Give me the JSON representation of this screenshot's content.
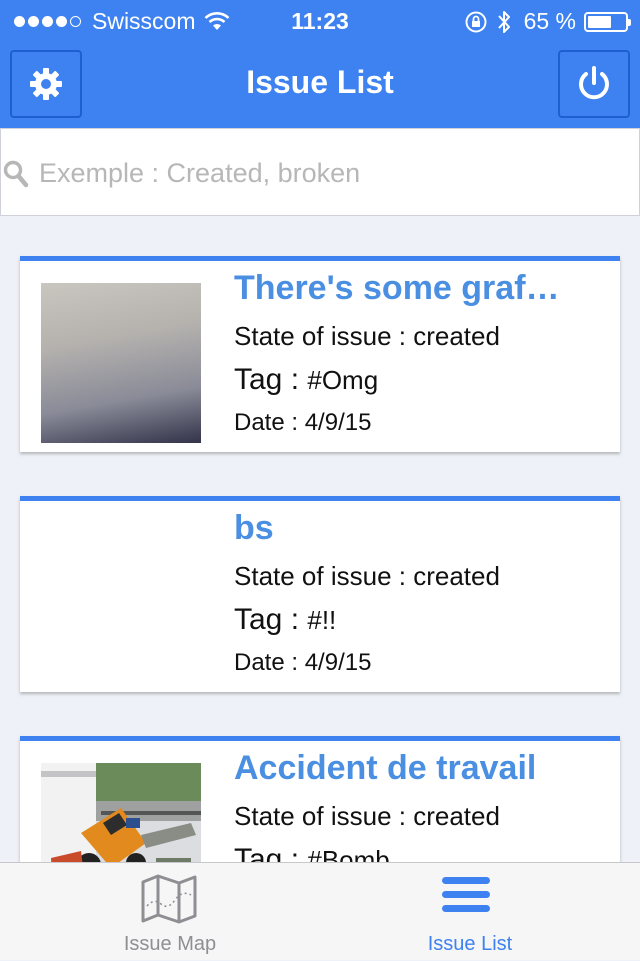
{
  "status_bar": {
    "carrier": "Swisscom",
    "time": "11:23",
    "battery": "65 %",
    "battery_level": 0.65,
    "signal_bars_filled": 4,
    "signal_bars_total": 5
  },
  "header": {
    "title": "Issue List",
    "left_icon": "gear-icon",
    "right_icon": "power-icon"
  },
  "search": {
    "placeholder": "Exemple : Created, broken",
    "value": ""
  },
  "issues": [
    {
      "title": "There's some graf…",
      "state": "State of issue : created",
      "tag_label": "Tag : ",
      "tag_value": "#Omg",
      "date": "Date : 4/9/15",
      "thumbnail": "blurred-wall-photo"
    },
    {
      "title": "bs",
      "state": "State of issue : created",
      "tag_label": "Tag : ",
      "tag_value": "#!!",
      "date": "Date : 4/9/15",
      "thumbnail": ""
    },
    {
      "title": "Accident de travail",
      "state": "State of issue : created",
      "tag_label": "Tag : ",
      "tag_value": "#Bomb",
      "date": "",
      "thumbnail": "forklift-accident-photo"
    }
  ],
  "tabs": [
    {
      "label": "Issue Map",
      "icon": "map-icon",
      "active": false
    },
    {
      "label": "Issue List",
      "icon": "list-icon",
      "active": true
    }
  ],
  "colors": {
    "accent": "#3d82f0",
    "title_text": "#4a8fe2",
    "inactive_tab": "#8e8e93"
  }
}
